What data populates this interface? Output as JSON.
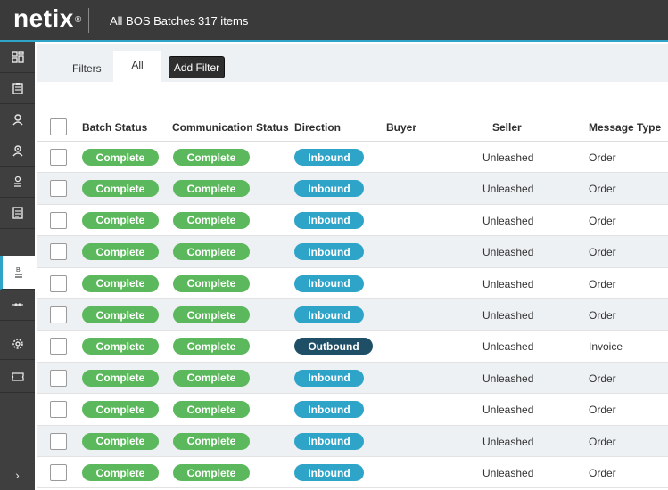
{
  "app": {
    "logo": "netix",
    "logo_mark": "®",
    "title": "All BOS Batches",
    "count": "317 items"
  },
  "sidebar": {
    "items": [
      {
        "name": "dashboard-icon"
      },
      {
        "name": "clipboard-icon"
      },
      {
        "name": "buyer-icon"
      },
      {
        "name": "seller-icon"
      },
      {
        "name": "stack-icon"
      },
      {
        "name": "document-icon"
      },
      {
        "name": "batch-icon",
        "active": true
      },
      {
        "name": "connection-icon"
      },
      {
        "name": "gear-icon"
      },
      {
        "name": "ticket-icon"
      }
    ],
    "expand_label": "›"
  },
  "filters": {
    "filters_label": "Filters",
    "tab_all": "All",
    "add_filter": "Add Filter"
  },
  "table": {
    "headers": {
      "batch_status": "Batch Status",
      "communication_status": "Communication Status",
      "direction": "Direction",
      "buyer": "Buyer",
      "seller": "Seller",
      "message_type": "Message Type"
    },
    "rows": [
      {
        "batch_status": "Complete",
        "communication_status": "Complete",
        "direction": "Inbound",
        "buyer": "",
        "seller": "Unleashed",
        "message_type": "Order"
      },
      {
        "batch_status": "Complete",
        "communication_status": "Complete",
        "direction": "Inbound",
        "buyer": "",
        "seller": "Unleashed",
        "message_type": "Order"
      },
      {
        "batch_status": "Complete",
        "communication_status": "Complete",
        "direction": "Inbound",
        "buyer": "",
        "seller": "Unleashed",
        "message_type": "Order"
      },
      {
        "batch_status": "Complete",
        "communication_status": "Complete",
        "direction": "Inbound",
        "buyer": "",
        "seller": "Unleashed",
        "message_type": "Order"
      },
      {
        "batch_status": "Complete",
        "communication_status": "Complete",
        "direction": "Inbound",
        "buyer": "",
        "seller": "Unleashed",
        "message_type": "Order"
      },
      {
        "batch_status": "Complete",
        "communication_status": "Complete",
        "direction": "Inbound",
        "buyer": "",
        "seller": "Unleashed",
        "message_type": "Order"
      },
      {
        "batch_status": "Complete",
        "communication_status": "Complete",
        "direction": "Outbound",
        "buyer": "",
        "seller": "Unleashed",
        "message_type": "Invoice"
      },
      {
        "batch_status": "Complete",
        "communication_status": "Complete",
        "direction": "Inbound",
        "buyer": "",
        "seller": "Unleashed",
        "message_type": "Order"
      },
      {
        "batch_status": "Complete",
        "communication_status": "Complete",
        "direction": "Inbound",
        "buyer": "",
        "seller": "Unleashed",
        "message_type": "Order"
      },
      {
        "batch_status": "Complete",
        "communication_status": "Complete",
        "direction": "Inbound",
        "buyer": "",
        "seller": "Unleashed",
        "message_type": "Order"
      },
      {
        "batch_status": "Complete",
        "communication_status": "Complete",
        "direction": "Inbound",
        "buyer": "",
        "seller": "Unleashed",
        "message_type": "Order"
      }
    ]
  },
  "colors": {
    "accent": "#2fa4c9",
    "complete": "#5cb85c",
    "inbound": "#2fa4c9",
    "outbound": "#1f4f66",
    "topbar": "#3a3a3a"
  }
}
